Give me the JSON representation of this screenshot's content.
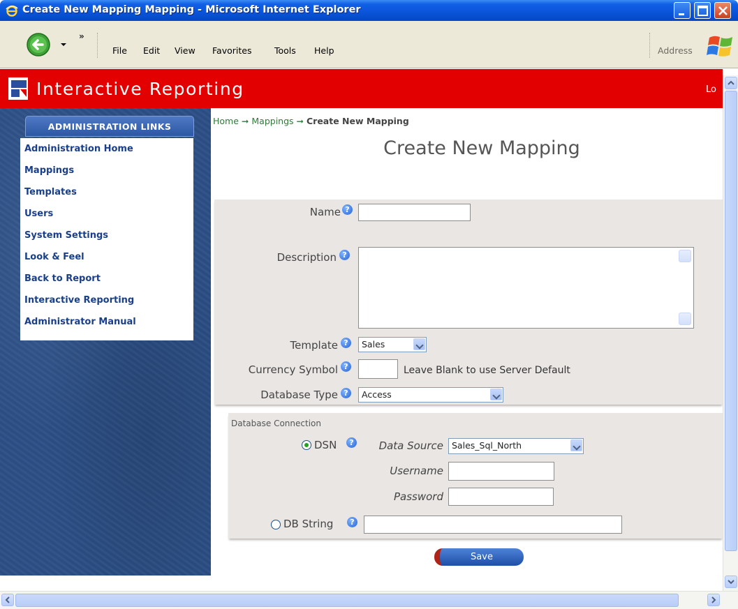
{
  "window": {
    "title": "Create New Mapping Mapping - Microsoft Internet Explorer"
  },
  "menu": {
    "items": [
      "File",
      "Edit",
      "View",
      "Favorites",
      "Tools",
      "Help"
    ],
    "address_label": "Address",
    "chevron": "»"
  },
  "banner": {
    "app_title": "Interactive Reporting",
    "logout_partial": "Lo"
  },
  "sidebar": {
    "header": "ADMINISTRATION LINKS",
    "links": [
      "Administration Home",
      "Mappings",
      "Templates",
      "Users",
      "System Settings",
      "Look & Feel",
      "Back to Report",
      "Interactive Reporting",
      "Administrator Manual"
    ]
  },
  "breadcrumb": {
    "home": "Home",
    "mappings": "Mappings",
    "current": "Create New Mapping",
    "separator": "➞"
  },
  "page": {
    "title": "Create New Mapping"
  },
  "form": {
    "name_label": "Name",
    "name_value": "",
    "description_label": "Description",
    "description_value": "",
    "template_label": "Template",
    "template_value": "Sales",
    "currency_label": "Currency Symbol",
    "currency_value": "",
    "currency_hint": "Leave Blank to use Server Default",
    "db_type_label": "Database Type",
    "db_type_value": "Access",
    "help_glyph": "?"
  },
  "db_connection": {
    "legend": "Database Connection",
    "dsn_label": "DSN",
    "dsn_selected": true,
    "data_source_label": "Data Source",
    "data_source_value": "Sales_Sql_North",
    "username_label": "Username",
    "username_value": "",
    "password_label": "Password",
    "password_value": "",
    "db_string_label": "DB String",
    "db_string_value": ""
  },
  "actions": {
    "save_label": "Save"
  },
  "icons": {
    "back": "back-arrow-icon",
    "help": "help-icon",
    "logo": "ir-logo-icon",
    "windows": "windows-logo-icon"
  },
  "colors": {
    "banner": "#e30000",
    "sidebar": "#2c4f86",
    "link": "#1a3f8a",
    "breadcrumb": "#2f7a3b",
    "panel": "#e9e6e4"
  }
}
